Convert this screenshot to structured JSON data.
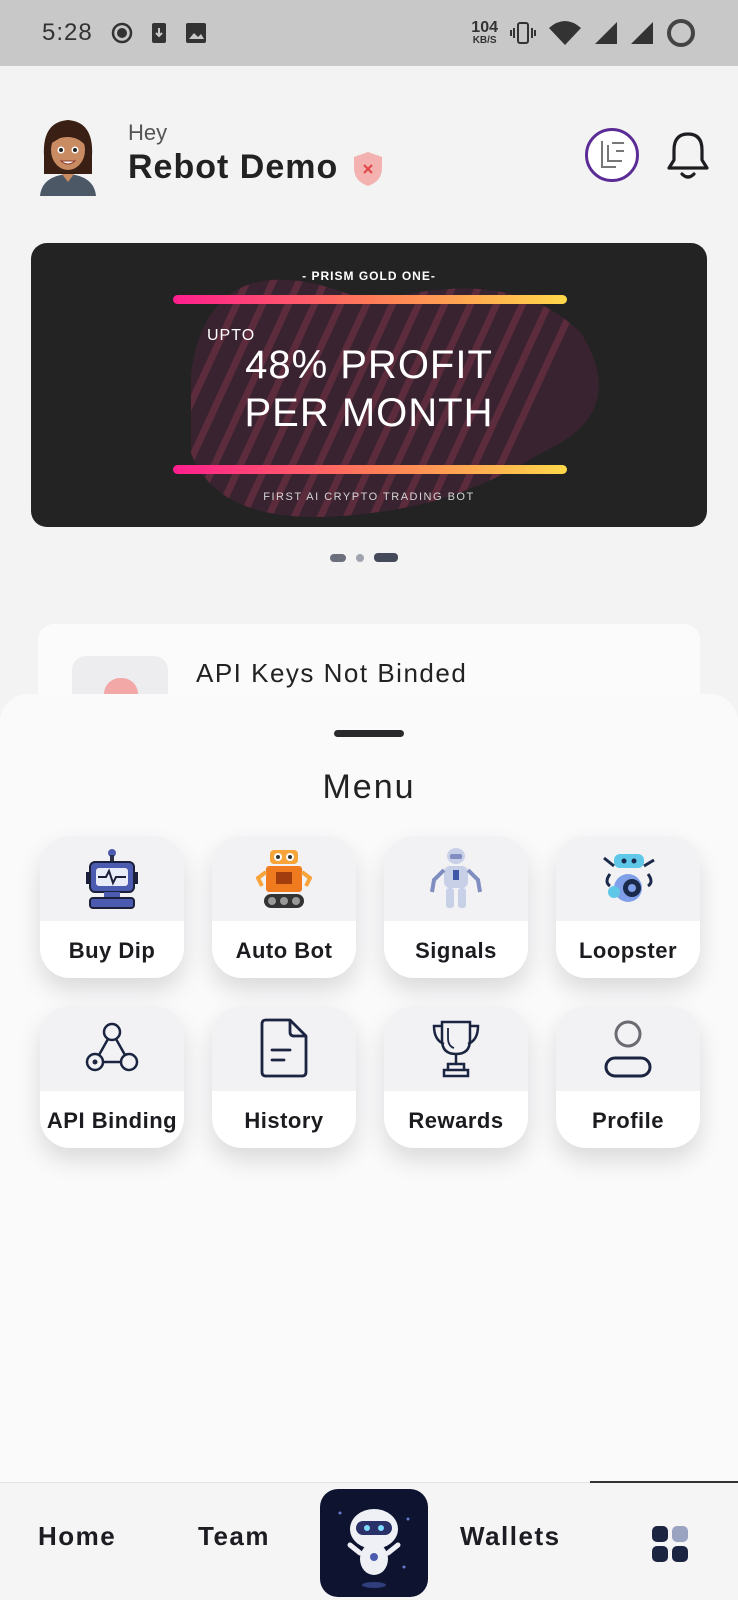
{
  "status_bar": {
    "time": "5:28",
    "net_speed_value": "104",
    "net_speed_unit": "KB/S",
    "icons": [
      "record-icon",
      "download-icon",
      "image-icon",
      "vibrate-icon",
      "wifi-icon",
      "signal-icon",
      "signal-icon",
      "battery-icon"
    ]
  },
  "header": {
    "greeting": "Hey",
    "username": "Rebot Demo",
    "verification_badge": "shield-x-icon",
    "actions": [
      "logo-icon",
      "bell-icon"
    ]
  },
  "banner": {
    "top_label": "- PRISM GOLD ONE-",
    "upto_label": "UPTO",
    "headline_line1": "48% PROFIT",
    "headline_line2": "PER MONTH",
    "footer_label": "FIRST AI CRYPTO TRADING BOT",
    "active_slide": 3,
    "slide_count": 3
  },
  "api_card": {
    "title": "API Keys Not Binded"
  },
  "menu": {
    "title": "Menu",
    "items": [
      {
        "label": "Buy Dip",
        "icon": "robot-monitor-icon"
      },
      {
        "label": "Auto Bot",
        "icon": "orange-robot-icon"
      },
      {
        "label": "Signals",
        "icon": "humanoid-robot-icon"
      },
      {
        "label": "Loopster",
        "icon": "wheel-robot-icon"
      },
      {
        "label": "API Binding",
        "icon": "share-nodes-icon"
      },
      {
        "label": "History",
        "icon": "document-icon"
      },
      {
        "label": "Rewards",
        "icon": "trophy-icon"
      },
      {
        "label": "Profile",
        "icon": "user-icon"
      }
    ]
  },
  "bottom_nav": {
    "home": "Home",
    "team": "Team",
    "center": "robot-mascot-icon",
    "wallets": "Wallets",
    "grid": "grid-icon"
  },
  "colors": {
    "banner_bg": "#232324",
    "banner_bar_start": "#ff1e8e",
    "banner_bar_end": "#ffd84a",
    "nav_center_bg": "#0e1330",
    "badge_bg": "#f3b1b0"
  }
}
